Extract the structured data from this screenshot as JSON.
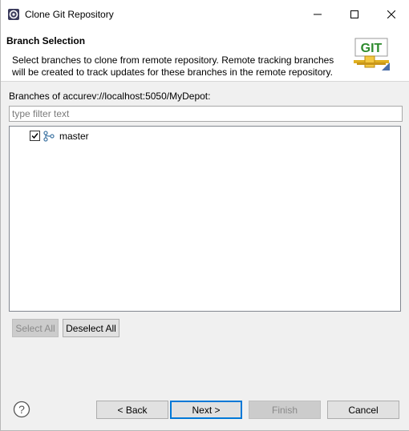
{
  "window": {
    "title": "Clone Git Repository",
    "controls": {
      "minimize": "minimize-icon",
      "maximize": "maximize-icon",
      "close": "close-icon"
    }
  },
  "header": {
    "title": "Branch Selection",
    "description": "Select branches to clone from remote repository. Remote tracking branches will be created to track updates for these branches in the remote repository.",
    "logo_text": "GIT"
  },
  "branches": {
    "label": "Branches of accurev://localhost:5050/MyDepot:",
    "filter_placeholder": "type filter text",
    "filter_value": "",
    "items": [
      {
        "name": "master",
        "checked": true,
        "icon": "branch-icon"
      }
    ]
  },
  "selection_buttons": {
    "select_all": "Select All",
    "deselect_all": "Deselect All"
  },
  "footer": {
    "help_icon": "help-icon",
    "back": "< Back",
    "next": "Next >",
    "finish": "Finish",
    "cancel": "Cancel"
  },
  "colors": {
    "header_bg": "#ffffff",
    "dialog_bg": "#f0f0f0",
    "default_button_border": "#0078d7",
    "logo_green": "#2c8a2c",
    "logo_gold": "#e0b020"
  }
}
